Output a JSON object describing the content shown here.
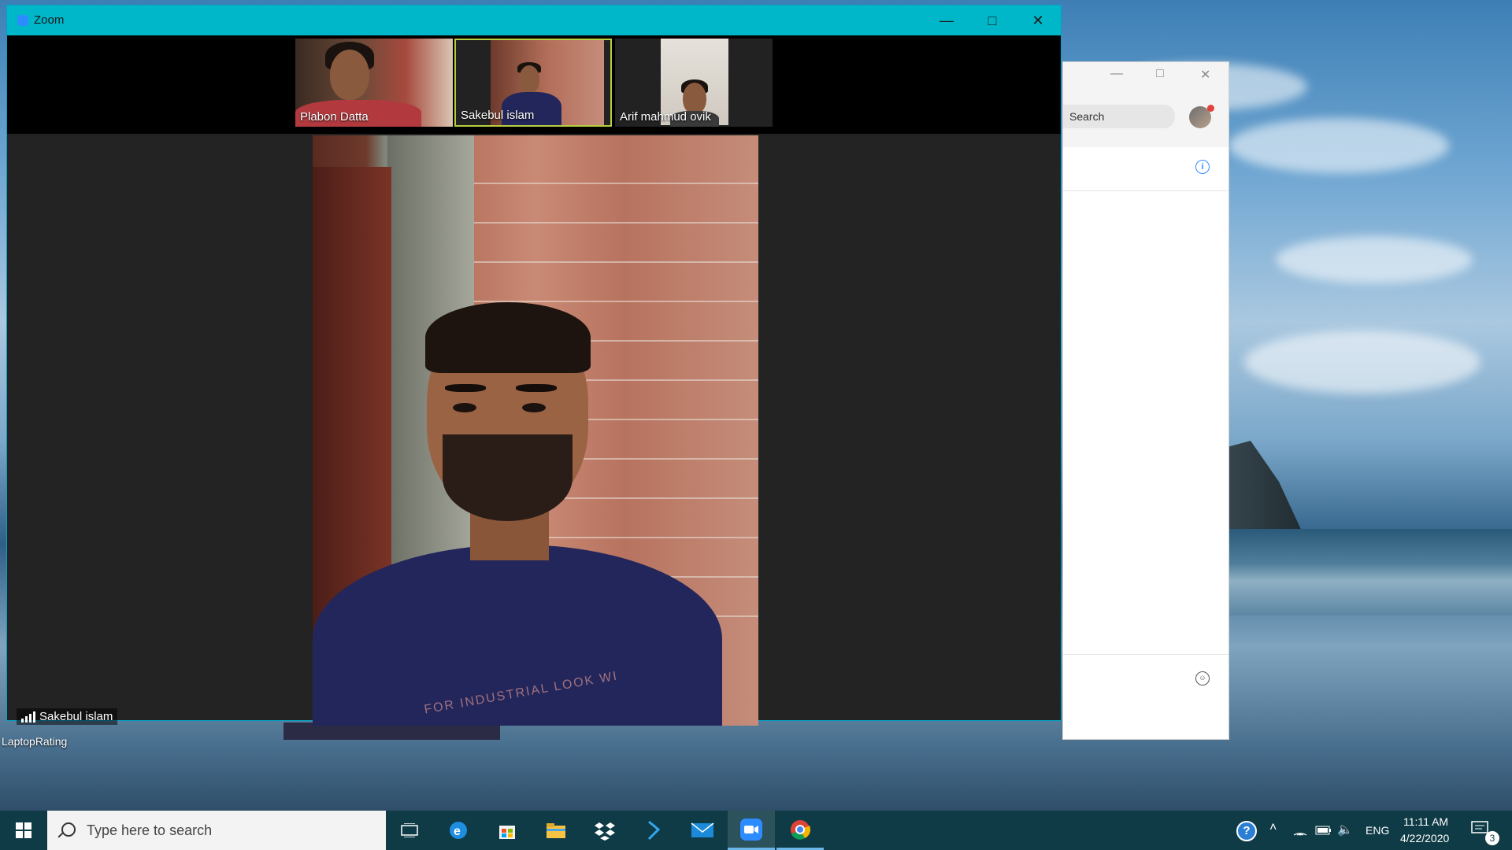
{
  "zoom_window": {
    "title": "Zoom",
    "participants": [
      {
        "name": "Plabon Datta",
        "active": false
      },
      {
        "name": "Sakebul islam",
        "active": true
      },
      {
        "name": "Arif mahmud ovik",
        "active": false
      }
    ],
    "main_speaker": "Sakebul islam",
    "shirt_text": "FOR INDUSTRIAL LOOK WI"
  },
  "chat_window": {
    "search_placeholder": "Search"
  },
  "desktop": {
    "icon_label": "LaptopRating"
  },
  "taskbar": {
    "search_placeholder": "Type here to search",
    "language": "ENG",
    "time": "11:11 AM",
    "date": "4/22/2020",
    "notification_count": "3",
    "pinned": [
      "task-view",
      "edge",
      "store",
      "file-explorer",
      "dropbox",
      "visual-studio",
      "mail",
      "zoom",
      "chrome"
    ]
  },
  "colors": {
    "zoom_titlebar": "#00b6c9",
    "taskbar": "#0f3b46",
    "active_tile_border": "#b7cf3e",
    "zoom_blue": "#2d8cff"
  }
}
